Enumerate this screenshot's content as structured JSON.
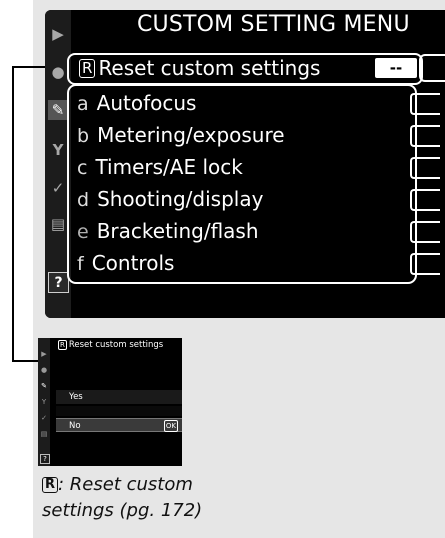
{
  "menu": {
    "title": "CUSTOM SETTING MENU",
    "reset": {
      "letter": "R",
      "label": "Reset custom settings",
      "value": "--"
    },
    "items": [
      {
        "letter": "a",
        "label": "Autofocus"
      },
      {
        "letter": "b",
        "label": "Metering/exposure"
      },
      {
        "letter": "c",
        "label": "Timers/AE lock"
      },
      {
        "letter": "d",
        "label": "Shooting/display"
      },
      {
        "letter": "e",
        "label": "Bracketing/flash"
      },
      {
        "letter": "f",
        "label": "Controls"
      }
    ],
    "tabs": [
      "playback-icon",
      "shooting-icon",
      "custom-setting-icon",
      "setup-icon",
      "retouch-icon",
      "my-menu-icon"
    ],
    "help_label": "?"
  },
  "sub_screen": {
    "title_letter": "R",
    "title": "Reset custom settings",
    "options": [
      {
        "label": "Yes"
      },
      {
        "label": "No",
        "badge": "OK"
      }
    ],
    "help_label": "?"
  },
  "caption": {
    "letter": "R",
    "text_line1": ": Reset custom",
    "text_line2": "settings (pg. 172)"
  }
}
